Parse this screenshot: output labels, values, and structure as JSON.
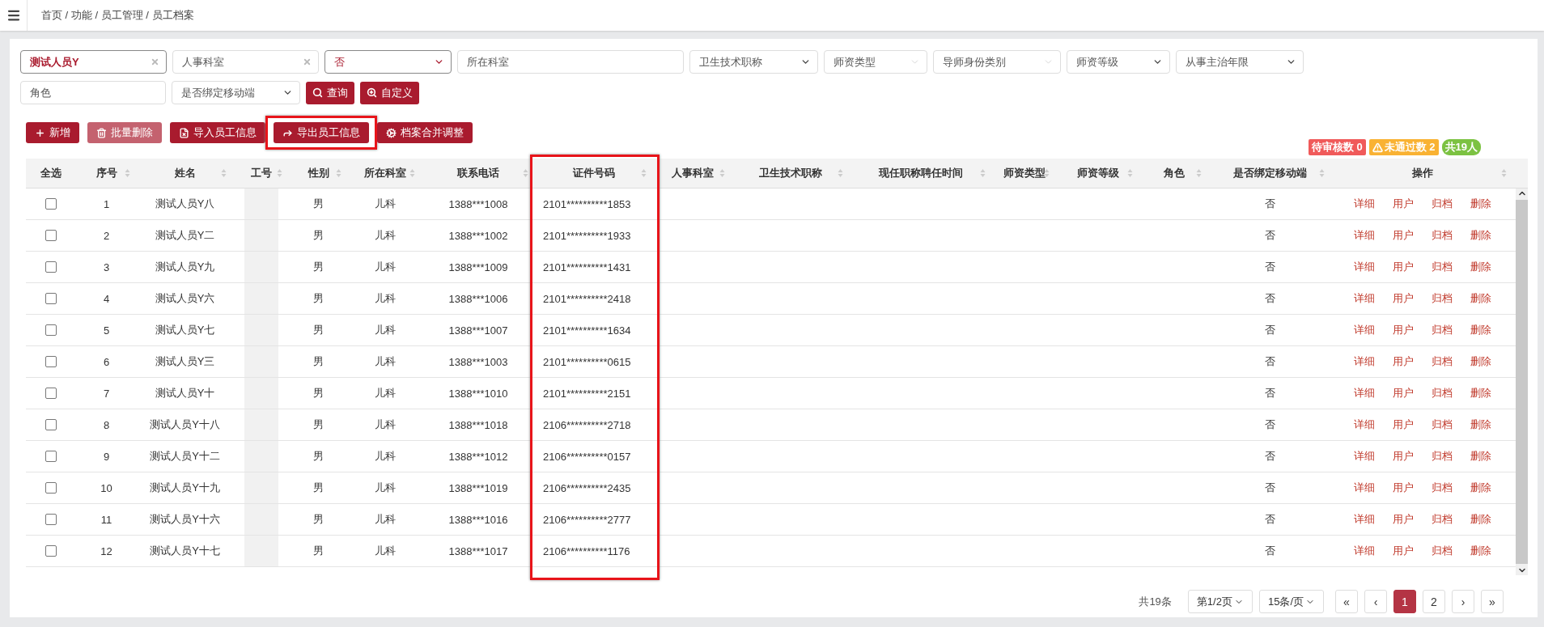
{
  "breadcrumb": "首页 / 功能 / 员工管理 / 员工档案",
  "filter_rows": [
    [
      {
        "kind": "input",
        "value": "测试人员Y",
        "clearable": true,
        "active": true
      },
      {
        "kind": "input",
        "placeholder": "人事科室",
        "clearable": true,
        "active": false
      },
      {
        "kind": "select",
        "value": "否",
        "active": true
      },
      {
        "kind": "input",
        "placeholder": "所在科室",
        "active": false
      },
      {
        "kind": "select",
        "placeholder": "卫生技术职称",
        "active": false
      },
      {
        "kind": "select",
        "placeholder": "师资类型",
        "disabled": true,
        "active": false
      },
      {
        "kind": "select",
        "placeholder": "导师身份类别",
        "disabled": true,
        "active": false
      },
      {
        "kind": "select",
        "placeholder": "师资等级",
        "active": false
      },
      {
        "kind": "select",
        "placeholder": "从事主治年限",
        "active": false
      }
    ],
    [
      {
        "kind": "input",
        "placeholder": "角色",
        "active": false
      },
      {
        "kind": "select",
        "placeholder": "是否绑定移动端",
        "active": false
      },
      {
        "kind": "button",
        "label": "查询"
      },
      {
        "kind": "button",
        "label": "自定义"
      }
    ]
  ],
  "toolbar": [
    {
      "label": "新增",
      "disabled": false,
      "highlighted": false
    },
    {
      "label": "批量删除",
      "disabled": true,
      "highlighted": false
    },
    {
      "label": "导入员工信息",
      "disabled": false,
      "highlighted": false
    },
    {
      "label": "导出员工信息",
      "disabled": false,
      "highlighted": true
    },
    {
      "label": "档案合并调整",
      "disabled": false,
      "highlighted": false
    }
  ],
  "badges": [
    {
      "label": "待审核数 0",
      "color": "#f05a5a",
      "warning": false
    },
    {
      "label": "未通过数 2",
      "color": "#f9b233",
      "warning": true
    },
    {
      "label": "共19人",
      "color": "#7cc242",
      "warning": false
    }
  ],
  "table": {
    "columns": [
      {
        "label": "全选",
        "sortable": false,
        "highlighted": false
      },
      {
        "label": "序号",
        "sortable": true,
        "highlighted": false
      },
      {
        "label": "姓名",
        "sortable": true,
        "highlighted": false
      },
      {
        "label": "工号",
        "sortable": true,
        "highlighted": false
      },
      {
        "label": "性别",
        "sortable": true,
        "highlighted": false
      },
      {
        "label": "所在科室",
        "sortable": true,
        "highlighted": false
      },
      {
        "label": "联系电话",
        "sortable": true,
        "highlighted": false
      },
      {
        "label": "证件号码",
        "sortable": true,
        "highlighted": true
      },
      {
        "label": "人事科室",
        "sortable": true,
        "highlighted": false
      },
      {
        "label": "卫生技术职称",
        "sortable": true,
        "highlighted": false
      },
      {
        "label": "现任职称聘任时间",
        "sortable": true,
        "highlighted": false
      },
      {
        "label": "师资类型",
        "sortable": true,
        "highlighted": false
      },
      {
        "label": "师资等级",
        "sortable": true,
        "highlighted": false
      },
      {
        "label": "角色",
        "sortable": true,
        "highlighted": false
      },
      {
        "label": "是否绑定移动端",
        "sortable": true,
        "highlighted": false
      },
      {
        "label": "操作",
        "sortable": true,
        "highlighted": false
      }
    ],
    "rows": [
      {
        "checked": false,
        "no": "1",
        "name": "测试人员Y八",
        "gender": "男",
        "dept": "儿科",
        "phone": "1388***1008",
        "id_no": "2101**********1853",
        "bind": "否",
        "actions": [
          "详细",
          "用户",
          "归档",
          "删除"
        ]
      },
      {
        "checked": false,
        "no": "2",
        "name": "测试人员Y二",
        "gender": "男",
        "dept": "儿科",
        "phone": "1388***1002",
        "id_no": "2101**********1933",
        "bind": "否",
        "actions": [
          "详细",
          "用户",
          "归档",
          "删除"
        ]
      },
      {
        "checked": false,
        "no": "3",
        "name": "测试人员Y九",
        "gender": "男",
        "dept": "儿科",
        "phone": "1388***1009",
        "id_no": "2101**********1431",
        "bind": "否",
        "actions": [
          "详细",
          "用户",
          "归档",
          "删除"
        ]
      },
      {
        "checked": false,
        "no": "4",
        "name": "测试人员Y六",
        "gender": "男",
        "dept": "儿科",
        "phone": "1388***1006",
        "id_no": "2101**********2418",
        "bind": "否",
        "actions": [
          "详细",
          "用户",
          "归档",
          "删除"
        ]
      },
      {
        "checked": false,
        "no": "5",
        "name": "测试人员Y七",
        "gender": "男",
        "dept": "儿科",
        "phone": "1388***1007",
        "id_no": "2101**********1634",
        "bind": "否",
        "actions": [
          "详细",
          "用户",
          "归档",
          "删除"
        ]
      },
      {
        "checked": false,
        "no": "6",
        "name": "测试人员Y三",
        "gender": "男",
        "dept": "儿科",
        "phone": "1388***1003",
        "id_no": "2101**********0615",
        "bind": "否",
        "actions": [
          "详细",
          "用户",
          "归档",
          "删除"
        ]
      },
      {
        "checked": false,
        "no": "7",
        "name": "测试人员Y十",
        "gender": "男",
        "dept": "儿科",
        "phone": "1388***1010",
        "id_no": "2101**********2151",
        "bind": "否",
        "actions": [
          "详细",
          "用户",
          "归档",
          "删除"
        ]
      },
      {
        "checked": false,
        "no": "8",
        "name": "测试人员Y十八",
        "gender": "男",
        "dept": "儿科",
        "phone": "1388***1018",
        "id_no": "2106**********2718",
        "bind": "否",
        "actions": [
          "详细",
          "用户",
          "归档",
          "删除"
        ]
      },
      {
        "checked": false,
        "no": "9",
        "name": "测试人员Y十二",
        "gender": "男",
        "dept": "儿科",
        "phone": "1388***1012",
        "id_no": "2106**********0157",
        "bind": "否",
        "actions": [
          "详细",
          "用户",
          "归档",
          "删除"
        ]
      },
      {
        "checked": false,
        "no": "10",
        "name": "测试人员Y十九",
        "gender": "男",
        "dept": "儿科",
        "phone": "1388***1019",
        "id_no": "2106**********2435",
        "bind": "否",
        "actions": [
          "详细",
          "用户",
          "归档",
          "删除"
        ]
      },
      {
        "checked": false,
        "no": "11",
        "name": "测试人员Y十六",
        "gender": "男",
        "dept": "儿科",
        "phone": "1388***1016",
        "id_no": "2106**********2777",
        "bind": "否",
        "actions": [
          "详细",
          "用户",
          "归档",
          "删除"
        ]
      },
      {
        "checked": false,
        "no": "12",
        "name": "测试人员Y十七",
        "gender": "男",
        "dept": "儿科",
        "phone": "1388***1017",
        "id_no": "2106**********1176",
        "bind": "否",
        "actions": [
          "详细",
          "用户",
          "归档",
          "删除"
        ]
      }
    ]
  },
  "pagination": {
    "total": "共19条",
    "page_select": "第1/2页",
    "size_select": "15条/页",
    "buttons": [
      {
        "label": "«",
        "selected": false
      },
      {
        "label": "‹",
        "selected": false
      },
      {
        "label": "1",
        "selected": true
      },
      {
        "label": "2",
        "selected": false
      },
      {
        "label": "›",
        "selected": false
      },
      {
        "label": "»",
        "selected": false
      }
    ]
  }
}
